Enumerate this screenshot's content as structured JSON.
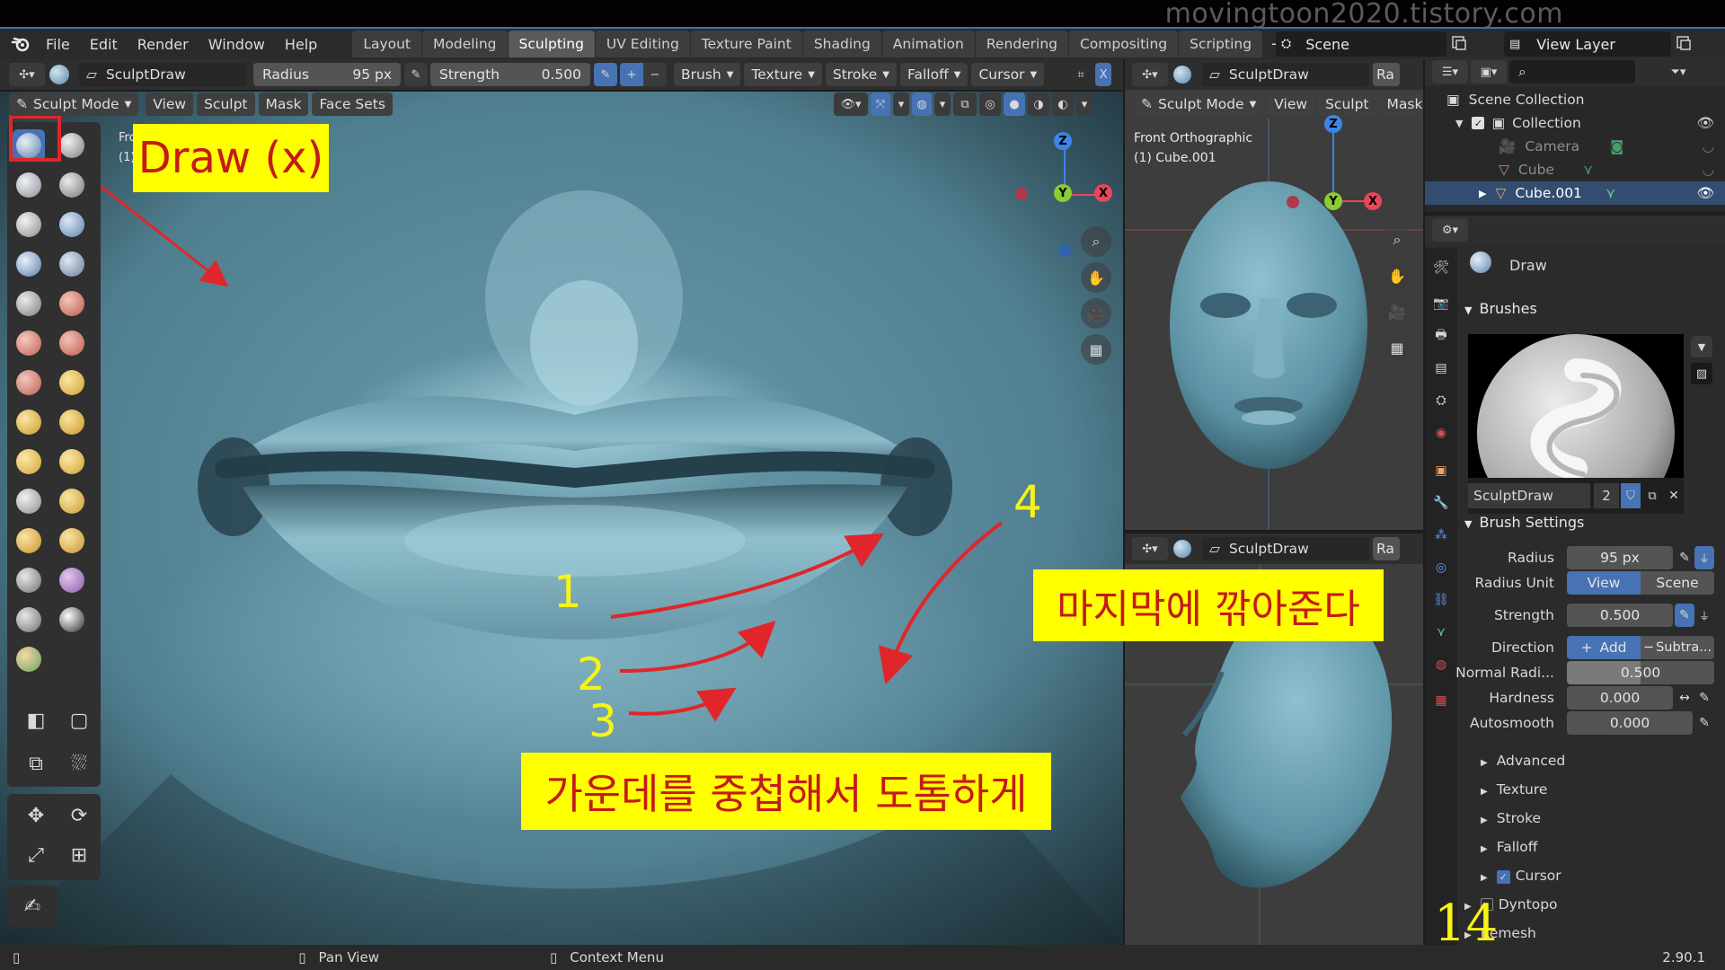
{
  "watermark": "movingtoon2020.tistory.com",
  "menu": [
    "File",
    "Edit",
    "Render",
    "Window",
    "Help"
  ],
  "workspaces": [
    "Layout",
    "Modeling",
    "Sculpting",
    "UV Editing",
    "Texture Paint",
    "Shading",
    "Animation",
    "Rendering",
    "Compositing",
    "Scripting"
  ],
  "active_workspace": "Sculpting",
  "scene": "Scene",
  "view_layer": "View Layer",
  "tool_header": {
    "brush_name": "SculptDraw",
    "radius_label": "Radius",
    "radius_value": "95 px",
    "strength_label": "Strength",
    "strength_value": "0.500",
    "plus": "+",
    "minus": "−",
    "menus": [
      "Brush",
      "Texture",
      "Stroke",
      "Falloff",
      "Cursor"
    ],
    "x_label": "X"
  },
  "viewport_header": {
    "mode": "Sculpt Mode",
    "items": [
      "View",
      "Sculpt",
      "Mask",
      "Face Sets"
    ]
  },
  "main_viewport": {
    "overlay_line1": "Fro",
    "overlay_line2": "(1)"
  },
  "gizmo": {
    "z": "Z",
    "y": "Y",
    "x": "X"
  },
  "right_top_viewport": {
    "brush_name": "SculptDraw",
    "ra": "Ra",
    "mode": "Sculpt Mode",
    "items": [
      "View",
      "Sculpt",
      "Mask"
    ],
    "line1": "Front Orthographic",
    "line2": "(1) Cube.001"
  },
  "right_bottom_viewport": {
    "brush_name": "SculptDraw",
    "ra": "Ra"
  },
  "outliner": {
    "scene_collection": "Scene Collection",
    "collection": "Collection",
    "items": [
      "Camera",
      "Cube",
      "Cube.001"
    ]
  },
  "properties": {
    "active_tool": "Draw",
    "brushes_header": "Brushes",
    "brush_name": "SculptDraw",
    "brush_users": "2",
    "brush_settings_header": "Brush Settings",
    "radius_label": "Radius",
    "radius_value": "95 px",
    "radius_unit_label": "Radius Unit",
    "radius_unit_view": "View",
    "radius_unit_scene": "Scene",
    "strength_label": "Strength",
    "strength_value": "0.500",
    "direction_label": "Direction",
    "direction_add": "Add",
    "direction_subtract": "Subtra...",
    "normal_radius_label": "Normal Radi...",
    "normal_radius_value": "0.500",
    "hardness_label": "Hardness",
    "hardness_value": "0.000",
    "autosmooth_label": "Autosmooth",
    "autosmooth_value": "0.000",
    "subpanels": [
      "Advanced",
      "Texture",
      "Stroke",
      "Falloff",
      "Cursor"
    ],
    "dyntopo": "Dyntopo",
    "remesh": "Remesh"
  },
  "statusbar": {
    "pan_view": "Pan View",
    "context_menu": "Context Menu",
    "version": "2.90.1"
  },
  "annotations": {
    "draw_label": "Draw (x)",
    "last_note": "마지막에 깎아준다",
    "middle_note": "가운데를 중첩해서 도톰하게",
    "num1": "1",
    "num2": "2",
    "num3": "3",
    "num4": "4",
    "page_number": "14"
  },
  "colors": {
    "accent": "#4772b3",
    "annotation_yellow": "#ffff00",
    "annotation_red": "#e0262a",
    "gizmo_x": "#e8475a",
    "gizmo_y": "#8bcb33",
    "gizmo_z": "#3c85e6",
    "clay": "#5b92a3"
  }
}
